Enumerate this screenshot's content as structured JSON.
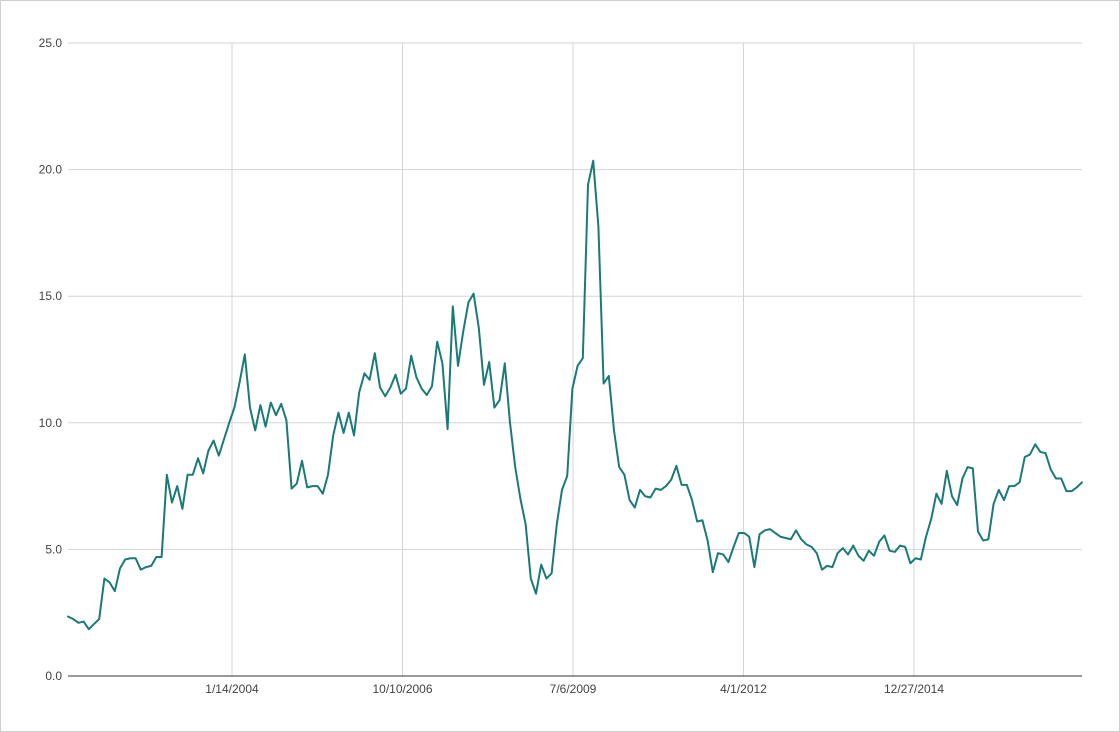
{
  "chart_data": {
    "type": "line",
    "title": "",
    "xlabel": "",
    "ylabel": "",
    "ylim": [
      0,
      25
    ],
    "yticks": [
      "0.0",
      "5.0",
      "10.0",
      "15.0",
      "20.0",
      "25.0"
    ],
    "xticks": [
      "1/14/2004",
      "10/10/2006",
      "7/6/2009",
      "4/1/2012",
      "12/27/2014"
    ],
    "grid": true,
    "legend": "none",
    "colors": {
      "line": "#1a7a78",
      "grid": "#d5d5d5",
      "axis": "#333333",
      "text": "#444444"
    },
    "series": [
      {
        "values": [
          2.35,
          2.25,
          2.1,
          2.15,
          1.85,
          2.05,
          2.25,
          3.85,
          3.7,
          3.35,
          4.25,
          4.6,
          4.65,
          4.65,
          4.2,
          4.3,
          4.35,
          4.7,
          4.7,
          7.95,
          6.85,
          7.5,
          6.6,
          7.95,
          7.95,
          8.6,
          8.0,
          8.9,
          9.3,
          8.7,
          9.35,
          10.0,
          10.6,
          11.6,
          12.7,
          10.6,
          9.7,
          10.7,
          9.85,
          10.8,
          10.3,
          10.75,
          10.1,
          7.4,
          7.6,
          8.5,
          7.45,
          7.5,
          7.5,
          7.2,
          7.95,
          9.5,
          10.4,
          9.6,
          10.4,
          9.5,
          11.2,
          11.95,
          11.7,
          12.75,
          11.4,
          11.05,
          11.4,
          11.9,
          11.15,
          11.35,
          12.65,
          11.8,
          11.35,
          11.1,
          11.45,
          13.2,
          12.35,
          9.75,
          14.6,
          12.25,
          13.6,
          14.75,
          15.1,
          13.75,
          11.5,
          12.4,
          10.6,
          10.9,
          12.35,
          10.0,
          8.25,
          7.0,
          6.0,
          3.85,
          3.25,
          4.4,
          3.85,
          4.05,
          6.0,
          7.35,
          7.9,
          11.35,
          12.25,
          12.55,
          19.4,
          20.35,
          17.75,
          11.55,
          11.85,
          9.7,
          8.25,
          7.95,
          6.95,
          6.65,
          7.35,
          7.1,
          7.05,
          7.4,
          7.35,
          7.5,
          7.75,
          8.3,
          7.55,
          7.55,
          6.95,
          6.1,
          6.15,
          5.35,
          4.1,
          4.85,
          4.8,
          4.5,
          5.1,
          5.65,
          5.65,
          5.5,
          4.3,
          5.6,
          5.75,
          5.8,
          5.65,
          5.5,
          5.45,
          5.4,
          5.75,
          5.4,
          5.2,
          5.1,
          4.85,
          4.2,
          4.35,
          4.3,
          4.85,
          5.05,
          4.8,
          5.15,
          4.75,
          4.55,
          4.95,
          4.75,
          5.3,
          5.55,
          4.95,
          4.9,
          5.15,
          5.1,
          4.45,
          4.65,
          4.6,
          5.5,
          6.2,
          7.2,
          6.8,
          8.1,
          7.1,
          6.75,
          7.8,
          8.25,
          8.2,
          5.7,
          5.35,
          5.4,
          6.8,
          7.35,
          6.95,
          7.5,
          7.5,
          7.65,
          8.65,
          8.75,
          9.15,
          8.85,
          8.8,
          8.15,
          7.8,
          7.8,
          7.3,
          7.3,
          7.45,
          7.65
        ]
      }
    ]
  }
}
